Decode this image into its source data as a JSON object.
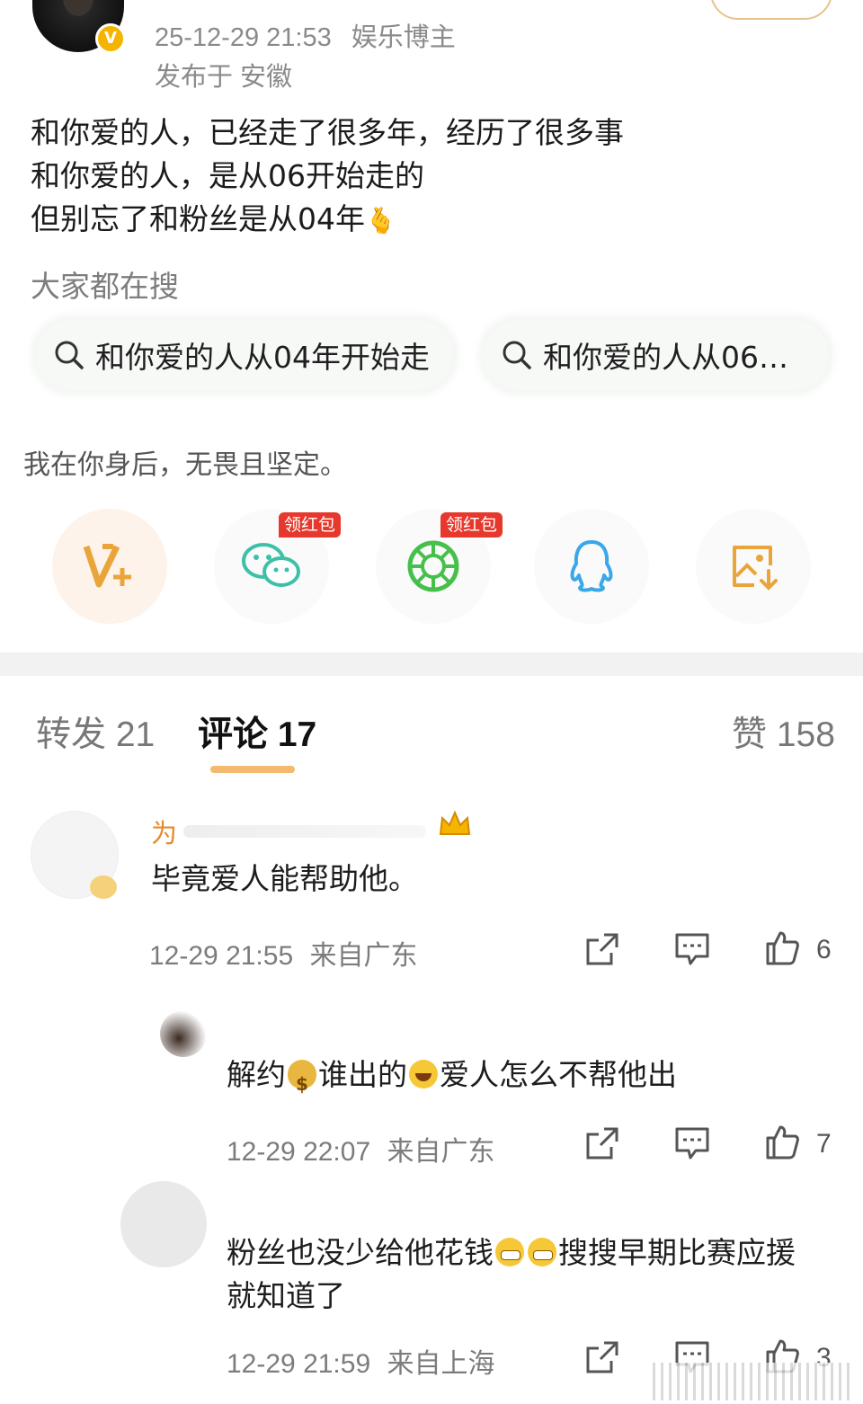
{
  "header": {
    "timestamp": "25-12-29 21:53",
    "author_tag": "娱乐博主",
    "location": "发布于 安徽",
    "verified_badge": "V"
  },
  "post": {
    "lines": [
      "和你爱的人，已经走了很多年，经历了很多事",
      "和你爱的人，是从06开始走的",
      "但别忘了和粉丝是从04年"
    ]
  },
  "search": {
    "title": "大家都在搜",
    "items": [
      "和你爱的人从04年开始走",
      "和你爱的人从06…"
    ]
  },
  "slogan": "我在你身后，无畏且坚定。",
  "share": {
    "redbag_label": "领红包",
    "targets": [
      "vplus-icon",
      "wechat-icon",
      "moments-icon",
      "qq-icon",
      "save-image-icon"
    ]
  },
  "tabs": {
    "repost": "转发 21",
    "comments": "评论 17",
    "likes": "赞 158"
  },
  "comments": [
    {
      "name": "为",
      "text": "毕竟爱人能帮助他。",
      "time": "12-29 21:55",
      "location": "来自广东",
      "likes": "6"
    },
    {
      "text_before": "解约",
      "text_middle": "谁出的",
      "text_after": "爱人怎么不帮他出",
      "time": "12-29 22:07",
      "location": "来自广东",
      "likes": "7"
    },
    {
      "text_line1": "粉丝也没少给他花钱",
      "text_line1_rest": "搜搜早期比赛应援",
      "text_line2": "就知道了",
      "time": "12-29 21:59",
      "location": "来自上海",
      "likes": "3"
    }
  ],
  "colors": {
    "accent": "#f0a84a",
    "verified": "#f5b400",
    "redbag": "#e6382c",
    "wechat": "#3cc1a8",
    "qq": "#3aa7e8",
    "save": "#e9a53a"
  }
}
